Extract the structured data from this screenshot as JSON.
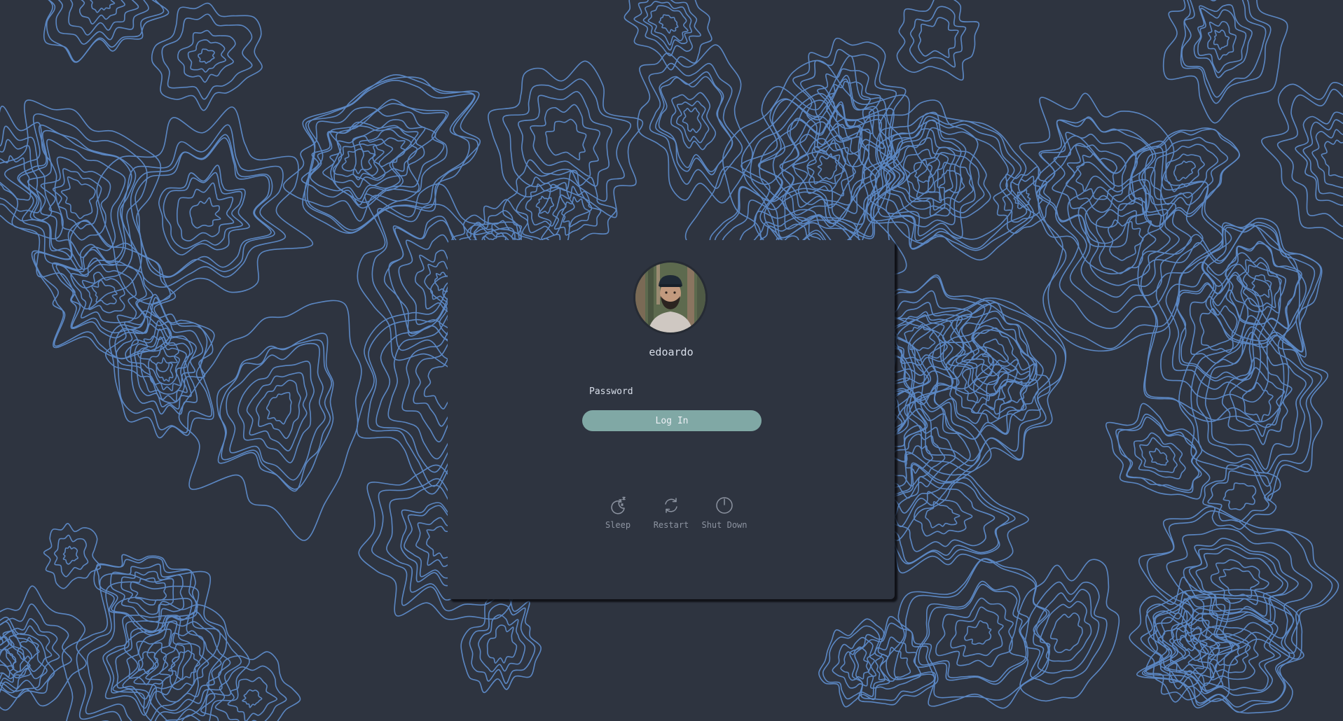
{
  "login": {
    "username": "edoardo",
    "password_placeholder": "Password",
    "login_label": "Log In"
  },
  "power": {
    "sleep_label": "Sleep",
    "restart_label": "Restart",
    "shutdown_label": "Shut Down"
  },
  "icons": {
    "sleep": "moon-zzz-icon",
    "restart": "restart-icon",
    "shutdown": "power-icon"
  },
  "colors": {
    "background": "#2e3440",
    "contour_lines": "#5e8ccb",
    "card": "#2e3440",
    "login_button": "#80a8a5",
    "text": "#d8dee9",
    "muted_text": "#8c93a0"
  }
}
